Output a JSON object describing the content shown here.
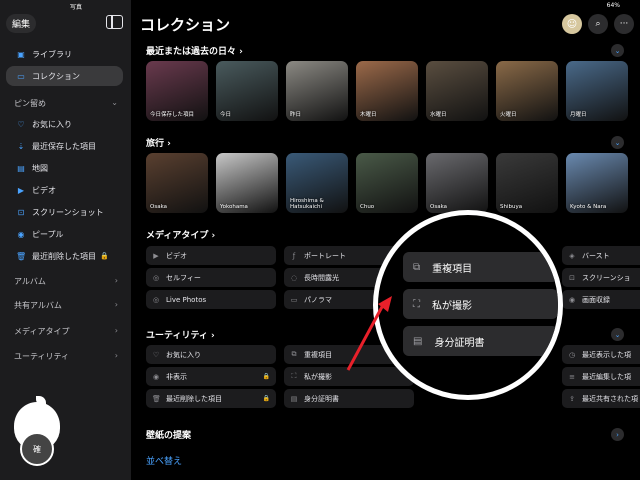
{
  "status": {
    "left": "写真",
    "right": "64%"
  },
  "sidebar": {
    "edit": "編集",
    "items": [
      {
        "label": "ライブラリ",
        "icon": "▣"
      },
      {
        "label": "コレクション",
        "icon": "▭"
      }
    ],
    "pinned_title": "ピン留め",
    "pinned": [
      {
        "label": "お気に入り",
        "icon": "♡"
      },
      {
        "label": "最近保存した項目",
        "icon": "⇣"
      },
      {
        "label": "地図",
        "icon": "▤"
      },
      {
        "label": "ビデオ",
        "icon": "▶"
      },
      {
        "label": "スクリーンショット",
        "icon": "⊡"
      },
      {
        "label": "ピープル",
        "icon": "◉"
      },
      {
        "label": "最近削除した項目",
        "icon": "🗑"
      }
    ],
    "sections": [
      {
        "label": "アルバム"
      },
      {
        "label": "共有アルバム"
      },
      {
        "label": "メディアタイプ"
      },
      {
        "label": "ユーティリティ"
      }
    ]
  },
  "header": {
    "title": "コレクション"
  },
  "recent": {
    "title": "最近または過去の日々",
    "tiles": [
      {
        "label": "今日保存した項目",
        "color": "#6a3a4e"
      },
      {
        "label": "今日",
        "color": "#4a5b5e"
      },
      {
        "label": "昨日",
        "color": "#8c8a84"
      },
      {
        "label": "木曜日",
        "color": "#9c6a4a"
      },
      {
        "label": "水曜日",
        "color": "#5a4e40"
      },
      {
        "label": "火曜日",
        "color": "#8a6a48"
      },
      {
        "label": "月曜日",
        "color": "#4a6a8a"
      }
    ]
  },
  "travel": {
    "title": "旅行",
    "tiles": [
      {
        "label": "Osaka",
        "color": "#5a4030"
      },
      {
        "label": "Yokohama",
        "color": "#c8c8c8"
      },
      {
        "label": "Hiroshima & Hatsukaichi",
        "color": "#3a5a78"
      },
      {
        "label": "Chuo",
        "color": "#4a5a48"
      },
      {
        "label": "Osaka",
        "color": "#6a6a6e"
      },
      {
        "label": "Shibuya",
        "color": "#3a3a3a"
      },
      {
        "label": "Kyoto & Nara",
        "color": "#6a8ab0"
      }
    ]
  },
  "media": {
    "title": "メディアタイプ",
    "cells": [
      {
        "label": "ビデオ",
        "icon": "▶",
        "lock": false
      },
      {
        "label": "ポートレート",
        "icon": "ƒ",
        "lock": false
      },
      {
        "label": "バースト",
        "icon": "◈",
        "lock": false
      },
      {
        "label": "セルフィー",
        "icon": "◎",
        "lock": false
      },
      {
        "label": "長時間露光",
        "icon": "◌",
        "lock": false
      },
      {
        "label": "スクリーンショ",
        "icon": "⊡",
        "lock": false
      },
      {
        "label": "Live Photos",
        "icon": "◎",
        "lock": false
      },
      {
        "label": "パノラマ",
        "icon": "▭",
        "lock": true
      },
      {
        "label": "画面収録",
        "icon": "◉",
        "lock": false
      }
    ]
  },
  "utility": {
    "title": "ユーティリティ",
    "cells": [
      {
        "label": "お気に入り",
        "icon": "♡",
        "lock": false
      },
      {
        "label": "重複項目",
        "icon": "⧉",
        "lock": false
      },
      {
        "label": "最近表示した項",
        "icon": "◷",
        "lock": false
      },
      {
        "label": "非表示",
        "icon": "◉",
        "lock": true
      },
      {
        "label": "私が撮影",
        "icon": "⛶",
        "lock": false
      },
      {
        "label": "最近編集した項",
        "icon": "≡",
        "lock": false
      },
      {
        "label": "最近削除した項目",
        "icon": "🗑",
        "lock": true
      },
      {
        "label": "身分証明書",
        "icon": "▤",
        "lock": false
      },
      {
        "label": "最近共有された項",
        "icon": "⇪",
        "lock": false
      }
    ]
  },
  "magnifier": [
    {
      "label": "重複項目",
      "icon": "⧉"
    },
    {
      "label": "私が撮影",
      "icon": "⛶"
    },
    {
      "label": "身分証明書",
      "icon": "▤"
    }
  ],
  "wallpaper": {
    "title": "壁紙の提案"
  },
  "sort": {
    "label": "並べ替え"
  },
  "logo_text": "確"
}
